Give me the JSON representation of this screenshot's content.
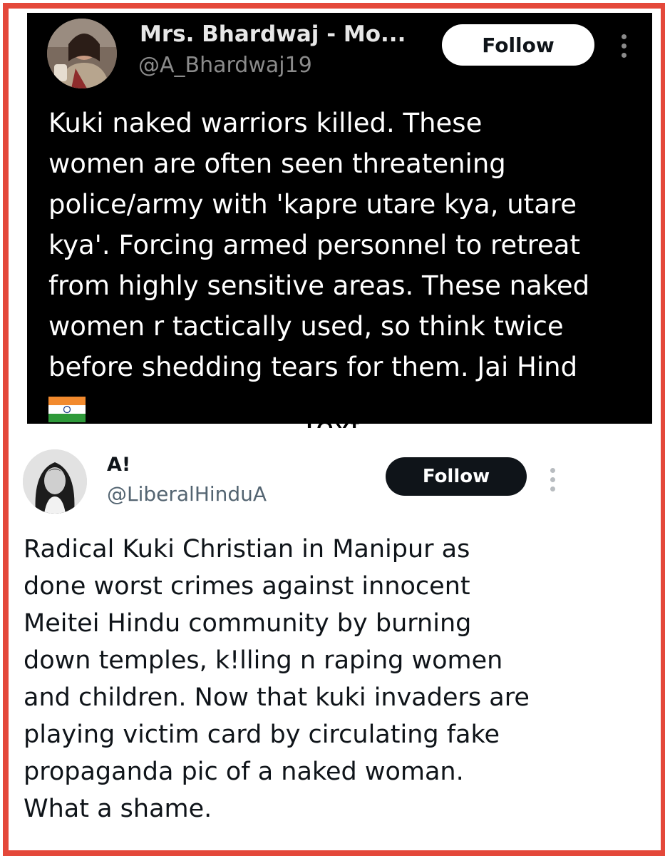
{
  "tweet1": {
    "display_name": "Mrs. Bhardwaj - Mo...",
    "handle": "@A_Bhardwaj19",
    "follow_label": "Follow",
    "text": "Kuki naked warriors killed. These\nwomen are often seen threatening\npolice/army with 'kapre utare kya, utare\nkya'. Forcing armed personnel to retreat\nfrom highly sensitive areas. These naked\nwomen r tactically used, so think twice\nbefore shedding tears for them. Jai Hind",
    "emoji": "india-flag-icon",
    "theme": "dark",
    "bg_color": "#000000"
  },
  "overlay_label": "Text",
  "tweet2": {
    "display_name": "A!",
    "handle": "@LiberalHinduA",
    "follow_label": "Follow",
    "text": "Radical Kuki Christian in Manipur as\ndone worst crimes against innocent\nMeitei Hindu community by burning\ndown temples, k!lling n raping women\nand children. Now that kuki invaders are\nplaying victim card by circulating fake\npropaganda pic of a naked woman.\nWhat a shame.",
    "theme": "light",
    "bg_color": "#ffffff"
  },
  "frame_color": "#e4483a",
  "icons": [
    "more-options-icon",
    "avatar",
    "india-flag-icon"
  ]
}
